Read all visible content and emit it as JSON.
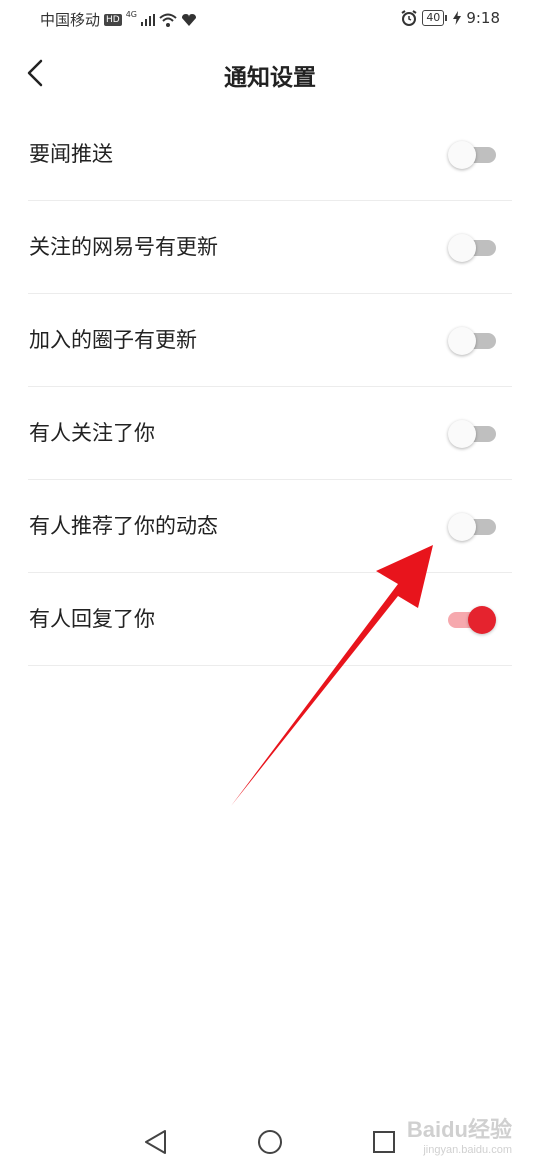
{
  "status_bar": {
    "carrier": "中国移动",
    "hd": "HD",
    "network": "4G",
    "battery": "40",
    "time": "9:18"
  },
  "header": {
    "title": "通知设置"
  },
  "settings": [
    {
      "label": "要闻推送",
      "on": false
    },
    {
      "label": "关注的网易号有更新",
      "on": false
    },
    {
      "label": "加入的圈子有更新",
      "on": false
    },
    {
      "label": "有人关注了你",
      "on": false
    },
    {
      "label": "有人推荐了你的动态",
      "on": false
    },
    {
      "label": "有人回复了你",
      "on": true
    }
  ],
  "watermark": {
    "text": "Baidu经验",
    "sub": "jingyan.baidu.com"
  },
  "colors": {
    "accent": "#e5232e",
    "arrow": "#e8141c"
  }
}
